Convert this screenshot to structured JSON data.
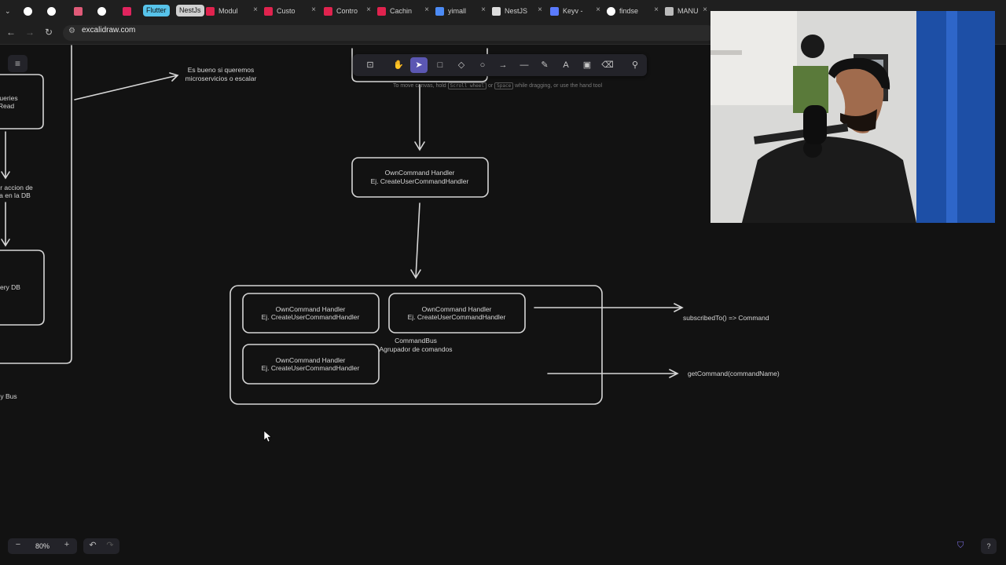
{
  "browser": {
    "tabs": [
      {
        "label": "",
        "icon": "github-icon",
        "color": "#ffffff"
      },
      {
        "label": "",
        "icon": "github-icon",
        "color": "#ffffff"
      },
      {
        "label": "",
        "icon": "app-icon",
        "color": "#e05a78"
      },
      {
        "label": "",
        "icon": "github-icon",
        "color": "#ffffff"
      },
      {
        "label": "",
        "icon": "app-icon",
        "color": "#e0245e"
      },
      {
        "label": "Modul",
        "icon": "nestjs-icon",
        "color": "#e0234e"
      },
      {
        "label": "Custo",
        "icon": "nestjs-icon",
        "color": "#e0234e"
      },
      {
        "label": "Contro",
        "icon": "nestjs-icon",
        "color": "#e0234e"
      },
      {
        "label": "Cachin",
        "icon": "nestjs-icon",
        "color": "#e0234e"
      },
      {
        "label": "yimall",
        "icon": "doc-icon",
        "color": "#4c8bf5"
      },
      {
        "label": "NestJS",
        "icon": "chatgpt-icon",
        "color": "#dddddd"
      },
      {
        "label": "Keyv -",
        "icon": "keyv-icon",
        "color": "#5a7bff"
      },
      {
        "label": "findse",
        "icon": "github-icon",
        "color": "#ffffff"
      },
      {
        "label": "MANU",
        "icon": "globe-icon",
        "color": "#bbbbbb"
      }
    ],
    "pinned_groups": [
      {
        "label": "Flutter",
        "color": "#57c3ea"
      },
      {
        "label": "NestJs",
        "color": "#d0d0d0"
      }
    ],
    "url": "excalidraw.com"
  },
  "toolbar": {
    "tools": [
      "lock",
      "hand",
      "selection",
      "rectangle",
      "diamond",
      "ellipse",
      "arrow",
      "line",
      "draw",
      "text",
      "image",
      "eraser",
      "extra-tools"
    ],
    "active": "selection",
    "hint_parts": [
      "To move canvas, hold",
      "Scroll wheel",
      "or",
      "Space",
      "while dragging, or use the hand tool"
    ]
  },
  "canvas": {
    "left_texts": [
      "ueries",
      "Read",
      "r accion de",
      "a en la DB",
      "ery DB",
      "y Bus"
    ],
    "note": [
      "Es bueno si queremos",
      "microservicios o escalar"
    ],
    "handler_top": [
      "OwnCommand Handler",
      "Ej. CreateUserCommandHandler"
    ],
    "handler_a": [
      "OwnCommand Handler",
      "Ej. CreateUserCommandHandler"
    ],
    "handler_b": [
      "OwnCommand Handler",
      "Ej. CreateUserCommandHandler"
    ],
    "handler_c": [
      "OwnCommand Handler",
      "Ej. CreateUserCommandHandler"
    ],
    "bus_label": [
      "CommandBus",
      "Agrupador de comandos"
    ],
    "subscribed": "subscribedTo() => Command",
    "getcommand": "getCommand(commandName)"
  },
  "footer": {
    "zoom": "80%",
    "zoom_out": "−",
    "zoom_in": "+",
    "undo": "↶",
    "redo": "↷",
    "help": "?"
  }
}
